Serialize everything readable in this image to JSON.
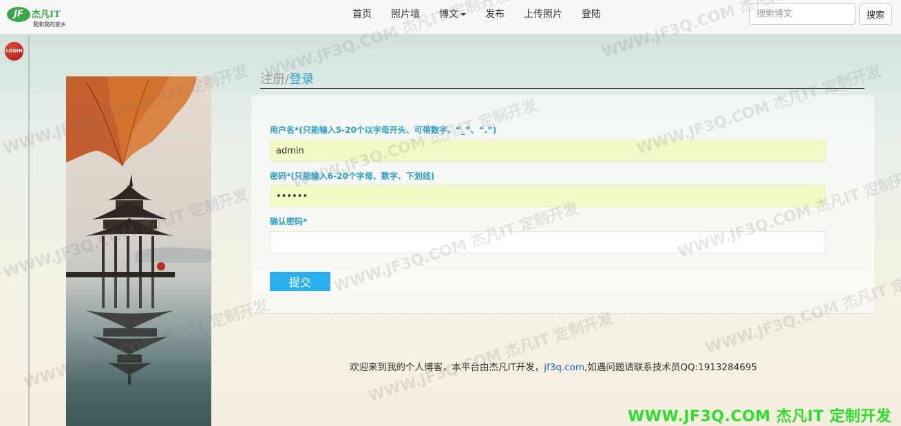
{
  "logo": {
    "mark": "JF",
    "name": "杰凡IT",
    "slogan": "我和我的家乡"
  },
  "nav": {
    "items": [
      {
        "label": "首页"
      },
      {
        "label": "照片墙"
      },
      {
        "label": "博文"
      },
      {
        "label": "发布"
      },
      {
        "label": "上传照片"
      },
      {
        "label": "登陆"
      }
    ]
  },
  "search": {
    "placeholder": "搜索博文",
    "button_label": "搜索"
  },
  "side": {
    "login_badge": "LOGIN"
  },
  "form": {
    "title_register": "注册",
    "title_separator": "/",
    "title_login": "登录",
    "username_label": "用户名*(只能输入5-20个以字母开头、可带数字、“_”、“.”)",
    "username_value": "admin",
    "password_label": "密码*(只能输入6-20个字母、数字、下划线)",
    "password_value": "••••••",
    "confirm_label": "确认密码*",
    "confirm_value": "",
    "submit_label": "提交"
  },
  "footer": {
    "text_before": "欢迎来到我的个人博客，本平台由杰凡IT开发，",
    "link": "jf3q.com",
    "text_after": ",如遇问题请联系技术员QQ:1913284695"
  },
  "brand_watermark": "WWW.JF3Q.COM 杰凡IT  定制开发",
  "watermark_text": "WWW.JF3Q.COM 杰凡IT  定制开发"
}
